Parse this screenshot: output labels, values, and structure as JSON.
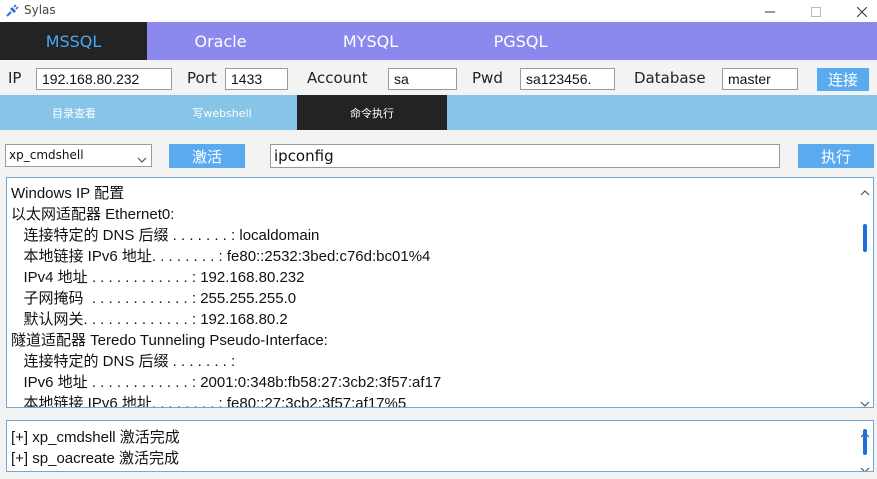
{
  "window": {
    "title": "Sylas"
  },
  "db_tabs": [
    {
      "label": "MSSQL",
      "active": true
    },
    {
      "label": "Oracle",
      "active": false
    },
    {
      "label": "MYSQL",
      "active": false
    },
    {
      "label": "PGSQL",
      "active": false
    }
  ],
  "connection": {
    "ip_label": "IP",
    "ip_value": "192.168.80.232",
    "port_label": "Port",
    "port_value": "1433",
    "account_label": "Account",
    "account_value": "sa",
    "pwd_label": "Pwd",
    "pwd_value": "sa123456.",
    "database_label": "Database",
    "database_value": "master",
    "connect_button": "连接"
  },
  "func_tabs": [
    {
      "label": "目录查看",
      "active": false
    },
    {
      "label": "写webshell",
      "active": false
    },
    {
      "label": "命令执行",
      "active": true
    }
  ],
  "command": {
    "method_selected": "xp_cmdshell",
    "activate_button": "激活",
    "command_value": "ipconfig",
    "execute_button": "执行"
  },
  "output_lines": [
    "Windows IP 配置",
    "以太网适配器 Ethernet0:",
    "   连接特定的 DNS 后缀 . . . . . . . : localdomain",
    "   本地链接 IPv6 地址. . . . . . . . : fe80::2532:3bed:c76d:bc01%4",
    "   IPv4 地址 . . . . . . . . . . . . : 192.168.80.232",
    "   子网掩码  . . . . . . . . . . . . : 255.255.255.0",
    "   默认网关. . . . . . . . . . . . . : 192.168.80.2",
    "隧道适配器 Teredo Tunneling Pseudo-Interface:",
    "   连接特定的 DNS 后缀 . . . . . . . :",
    "   IPv6 地址 . . . . . . . . . . . . : 2001:0:348b:fb58:27:3cb2:3f57:af17",
    "   本地链接 IPv6 地址. . . . . . . . : fe80::27:3cb2:3f57:af17%5"
  ],
  "log_lines": [
    "[+] xp_cmdshell 激活完成",
    "[+] sp_oacreate 激活完成"
  ],
  "colors": {
    "db_tab_bar": "#8b88ee",
    "func_tab_bar": "#87c5e8",
    "active_tab": "#232323",
    "button": "#5aaaf0"
  },
  "icons": {
    "app": "plug-icon",
    "minimize": "minimize-icon",
    "maximize": "maximize-icon",
    "close": "close-icon"
  }
}
